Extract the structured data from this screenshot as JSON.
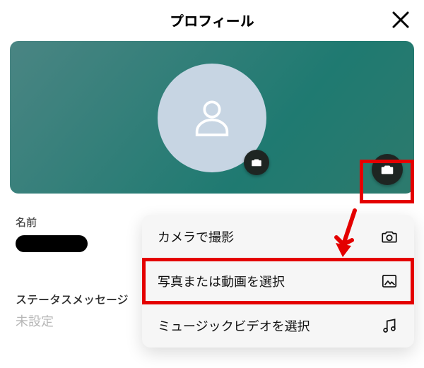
{
  "header": {
    "title": "プロフィール"
  },
  "sections": {
    "name": {
      "label": "名前",
      "value": ""
    },
    "status": {
      "label": "ステータスメッセージ",
      "value": "未設定"
    }
  },
  "menu": {
    "camera": "カメラで撮影",
    "select": "写真または動画を選択",
    "music": "ミュージックビデオを選択"
  },
  "colors": {
    "annotation": "#e40000"
  }
}
